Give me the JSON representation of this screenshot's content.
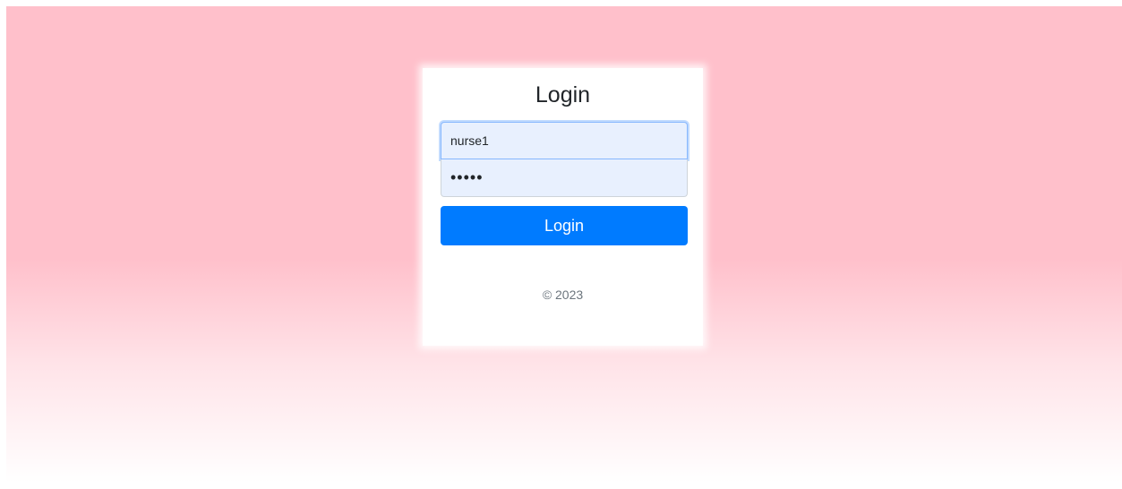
{
  "login": {
    "title": "Login",
    "username_value": "nurse1",
    "password_value": "•••••",
    "button_label": "Login",
    "footer": "© 2023"
  },
  "colors": {
    "background_top": "#ffc0cb",
    "background_bottom": "#ffffff",
    "card": "#ffffff",
    "button": "#007bff",
    "input_fill": "#e8f0fe"
  }
}
